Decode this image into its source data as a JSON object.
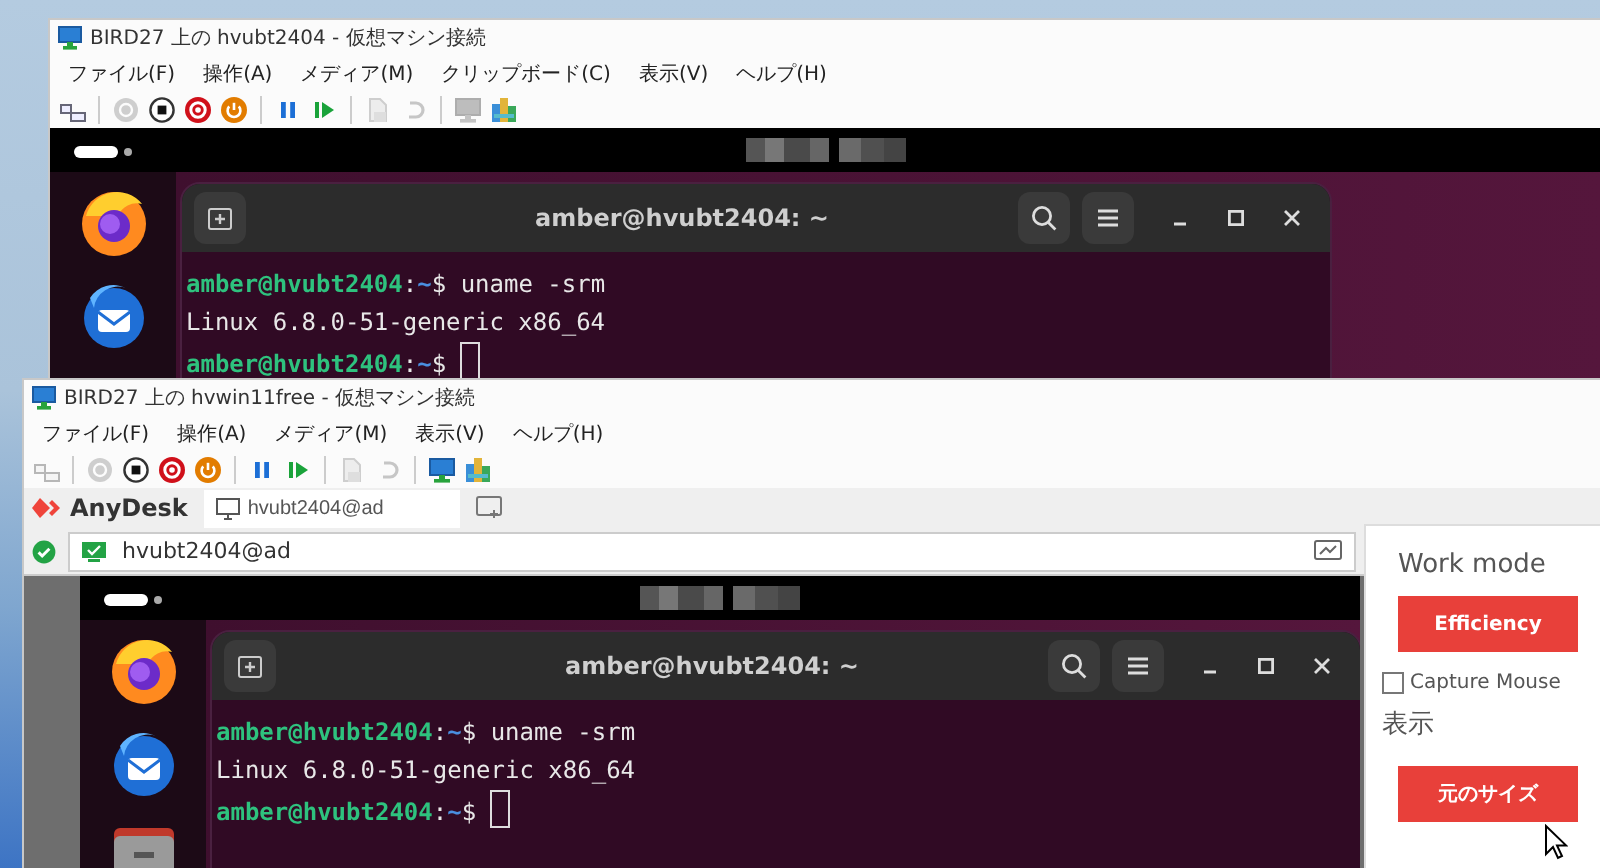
{
  "windows": [
    {
      "title": "BIRD27 上の hvubt2404 - 仮想マシン接続",
      "menu": [
        "ファイル(F)",
        "操作(A)",
        "メディア(M)",
        "クリップボード(C)",
        "表示(V)",
        "ヘルプ(H)"
      ],
      "toolbar": [
        {
          "kind": "ctrl-alt-del",
          "disabled": false
        },
        {
          "kind": "separator"
        },
        {
          "kind": "start",
          "disabled": true
        },
        {
          "kind": "stop",
          "disabled": false
        },
        {
          "kind": "turn-off",
          "disabled": false
        },
        {
          "kind": "shutdown",
          "disabled": false
        },
        {
          "kind": "separator"
        },
        {
          "kind": "pause",
          "disabled": false
        },
        {
          "kind": "resume",
          "disabled": false
        },
        {
          "kind": "separator"
        },
        {
          "kind": "checkpoint",
          "disabled": true
        },
        {
          "kind": "revert",
          "disabled": true
        },
        {
          "kind": "separator"
        },
        {
          "kind": "enhanced",
          "disabled": true
        },
        {
          "kind": "zoom",
          "disabled": false
        }
      ],
      "screen": {
        "dock": [
          {
            "kind": "browser"
          },
          {
            "kind": "mail"
          }
        ],
        "terminal_title": "amber@hvubt2404: ~",
        "lines": [
          {
            "kind": "prompt",
            "user": "amber@hvubt2404",
            "sep": ":",
            "path": "~",
            "sign": "$",
            "command": "uname -srm",
            "cursor": false
          },
          {
            "kind": "output",
            "text": "Linux 6.8.0-51-generic x86_64"
          },
          {
            "kind": "prompt",
            "user": "amber@hvubt2404",
            "sep": ":",
            "path": "~",
            "sign": "$",
            "cursor": true
          }
        ]
      }
    },
    {
      "title": "BIRD27 上の hvwin11free - 仮想マシン接続",
      "menu": [
        "ファイル(F)",
        "操作(A)",
        "メディア(M)",
        "表示(V)",
        "ヘルプ(H)"
      ],
      "toolbar": [
        {
          "kind": "ctrl-alt-del",
          "disabled": true
        },
        {
          "kind": "separator"
        },
        {
          "kind": "start",
          "disabled": true
        },
        {
          "kind": "stop",
          "disabled": false
        },
        {
          "kind": "turn-off",
          "disabled": false
        },
        {
          "kind": "shutdown",
          "disabled": false
        },
        {
          "kind": "separator"
        },
        {
          "kind": "pause",
          "disabled": false
        },
        {
          "kind": "resume",
          "disabled": false
        },
        {
          "kind": "separator"
        },
        {
          "kind": "checkpoint",
          "disabled": true
        },
        {
          "kind": "revert",
          "disabled": true
        },
        {
          "kind": "separator"
        },
        {
          "kind": "enhanced",
          "disabled": false
        },
        {
          "kind": "zoom",
          "disabled": false
        }
      ],
      "anydesk": {
        "logo": "AnyDesk",
        "tabs": [
          {
            "label": "hvubt2404@ad",
            "selected": true
          }
        ],
        "address": "hvubt2404@ad",
        "panel": {
          "work_mode_label": "Work mode",
          "mode_button": "Efficiency",
          "capture_mouse": {
            "label": "Capture Mouse",
            "checked": false
          },
          "display_label": "表示",
          "size_button": "元のサイズ"
        }
      },
      "screen": {
        "dock": [
          {
            "kind": "browser"
          },
          {
            "kind": "mail"
          },
          {
            "kind": "folder"
          }
        ],
        "terminal_title": "amber@hvubt2404: ~",
        "lines": [
          {
            "kind": "prompt",
            "user": "amber@hvubt2404",
            "sep": ":",
            "path": "~",
            "sign": "$",
            "command": "uname -srm",
            "cursor": false
          },
          {
            "kind": "output",
            "text": "Linux 6.8.0-51-generic x86_64"
          },
          {
            "kind": "prompt",
            "user": "amber@hvubt2404",
            "sep": ":",
            "path": "~",
            "sign": "$",
            "cursor": true
          }
        ]
      }
    }
  ]
}
